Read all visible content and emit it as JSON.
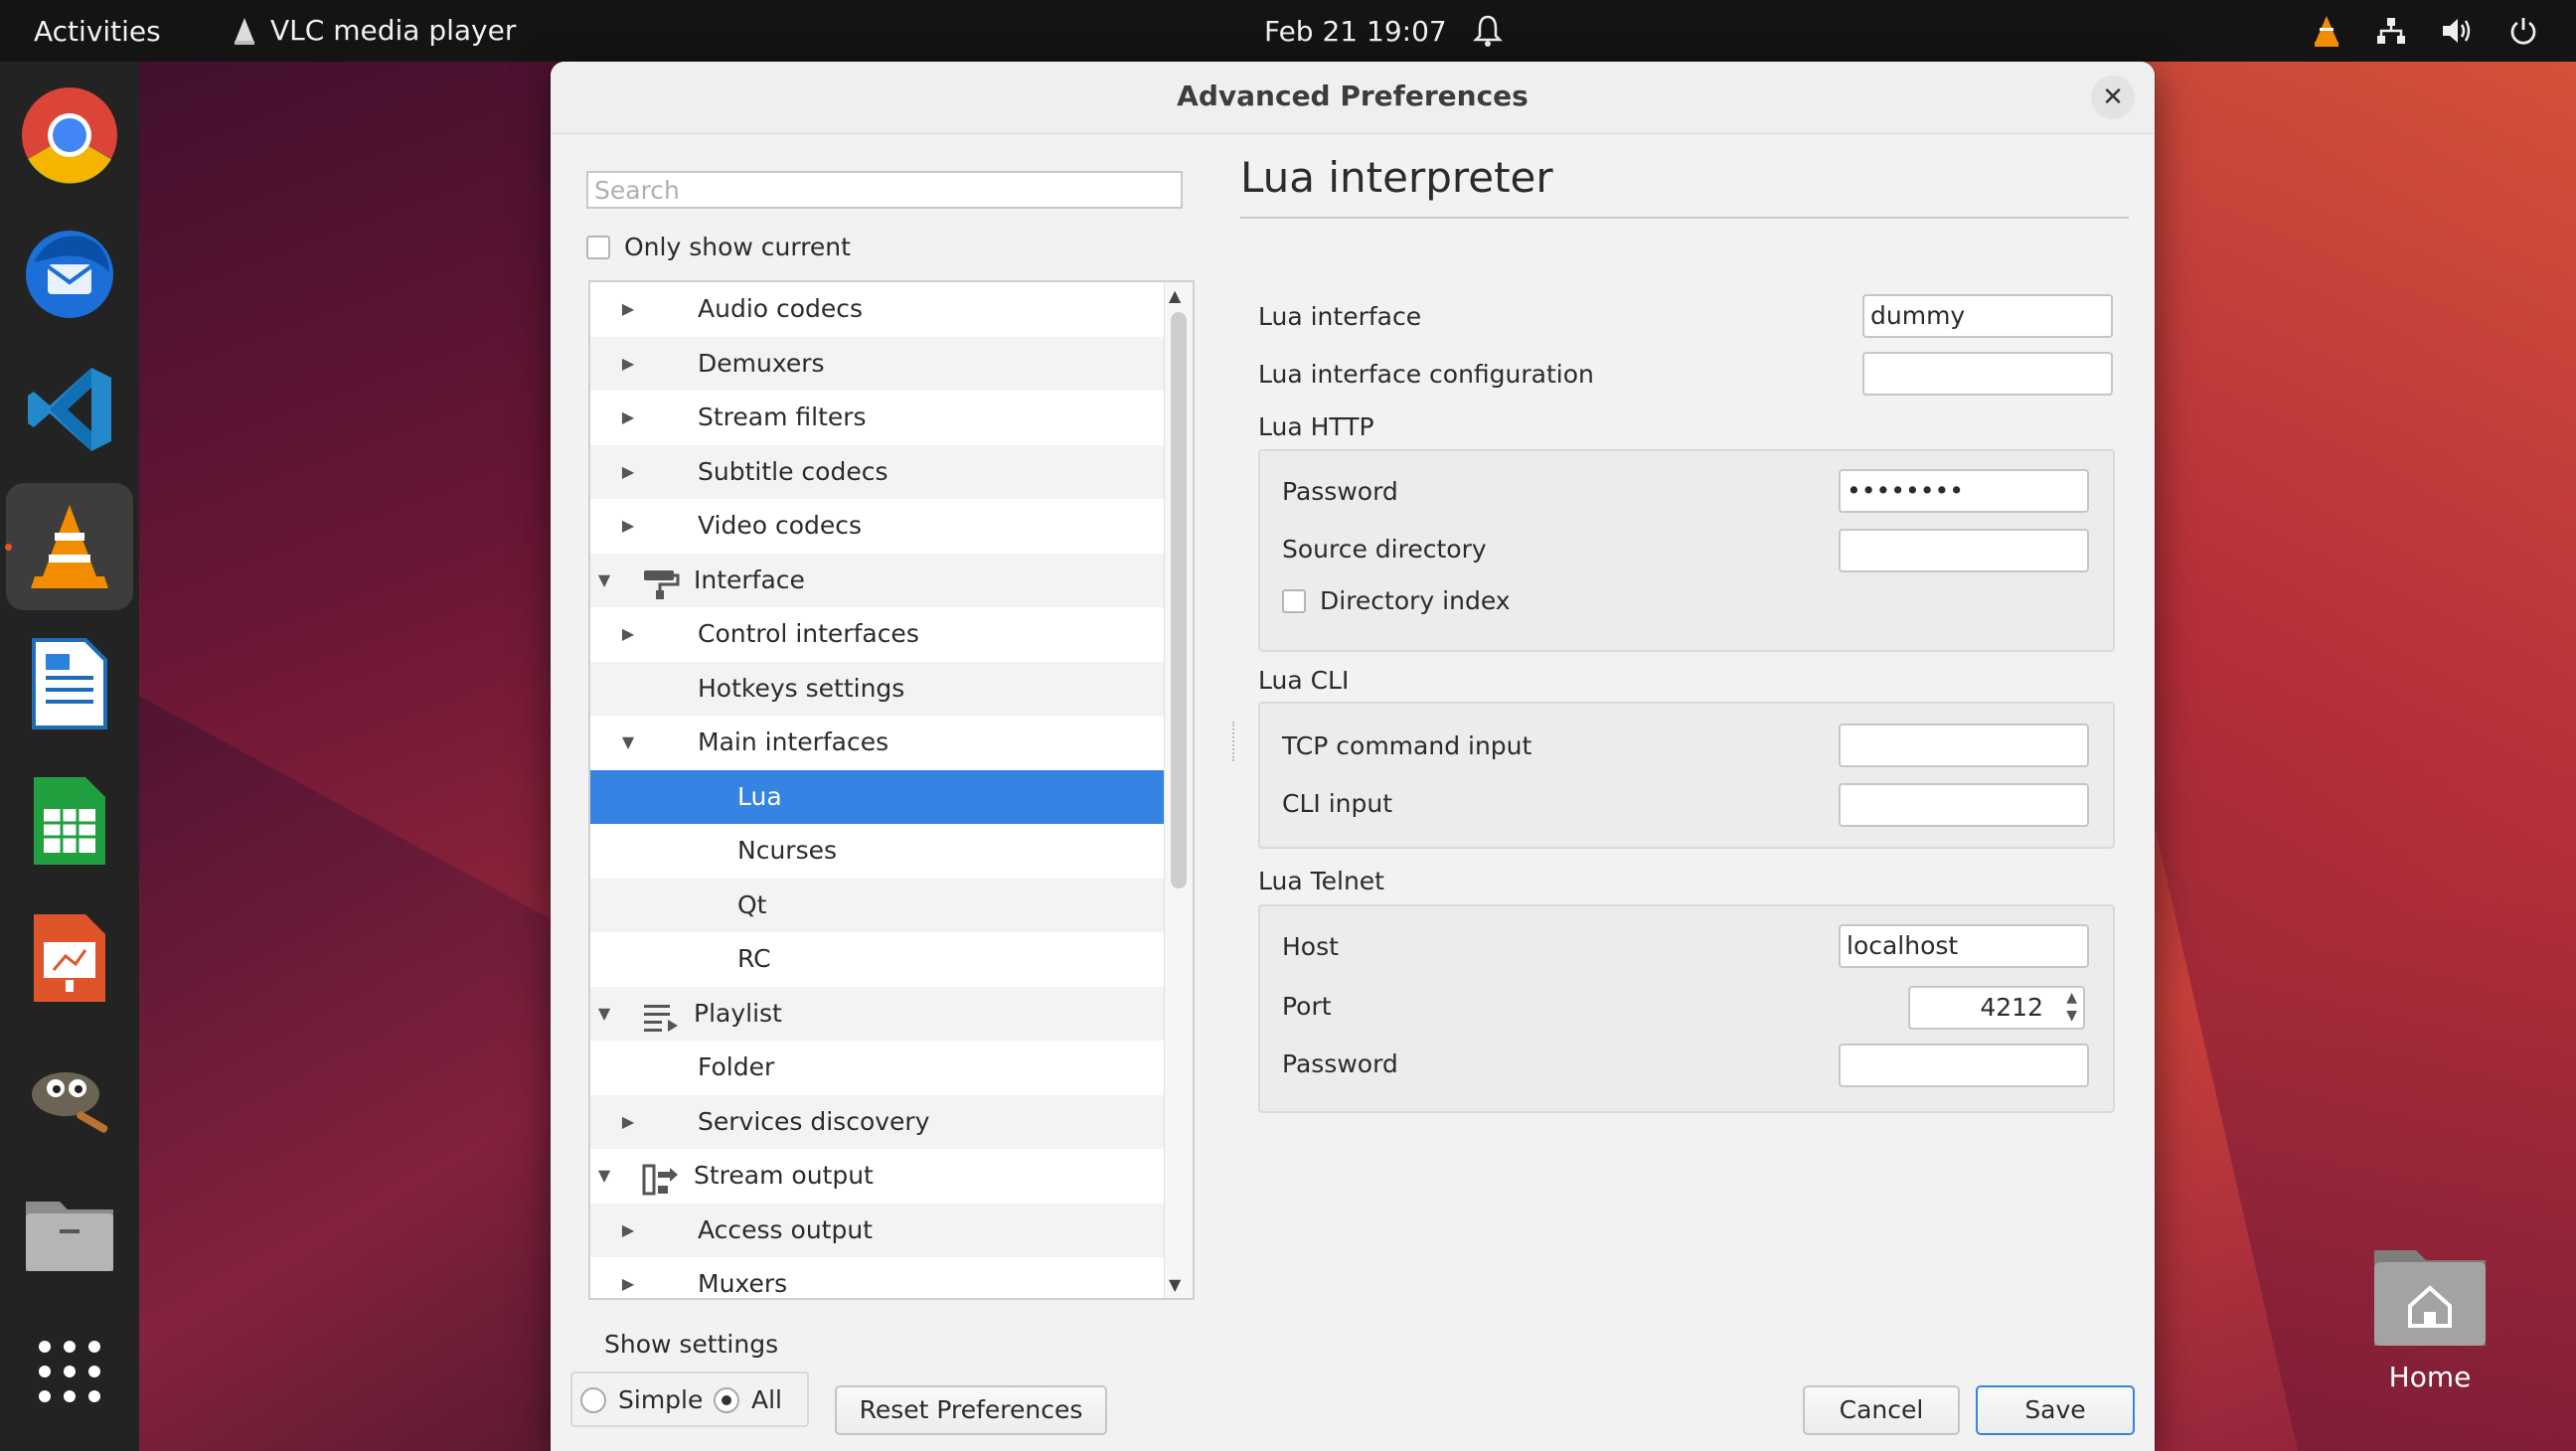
{
  "topbar": {
    "activities": "Activities",
    "app_name": "VLC media player",
    "clock": "Feb 21  19:07"
  },
  "dock": {
    "items": [
      "chrome-icon",
      "thunderbird-icon",
      "vscode-icon",
      "vlc-icon",
      "writer-icon",
      "calc-icon",
      "impress-icon",
      "gimp-icon",
      "files-icon",
      "app-grid-icon"
    ]
  },
  "desktop": {
    "home_label": "Home"
  },
  "dialog": {
    "title": "Advanced Preferences",
    "search_placeholder": "Search",
    "only_show_current": "Only show current",
    "tree": [
      {
        "label": "Audio codecs",
        "level": 1,
        "expander": "collapsed"
      },
      {
        "label": "Demuxers",
        "level": 1,
        "expander": "collapsed"
      },
      {
        "label": "Stream filters",
        "level": 1,
        "expander": "collapsed"
      },
      {
        "label": "Subtitle codecs",
        "level": 1,
        "expander": "collapsed"
      },
      {
        "label": "Video codecs",
        "level": 1,
        "expander": "collapsed"
      },
      {
        "label": "Interface",
        "level": 0,
        "expander": "expanded",
        "icon": "paint-roller-icon"
      },
      {
        "label": "Control interfaces",
        "level": 1,
        "expander": "collapsed"
      },
      {
        "label": "Hotkeys settings",
        "level": 1,
        "expander": "none"
      },
      {
        "label": "Main interfaces",
        "level": 1,
        "expander": "expanded"
      },
      {
        "label": "Lua",
        "level": 2,
        "expander": "none",
        "selected": true
      },
      {
        "label": "Ncurses",
        "level": 2,
        "expander": "none"
      },
      {
        "label": "Qt",
        "level": 2,
        "expander": "none"
      },
      {
        "label": "RC",
        "level": 2,
        "expander": "none"
      },
      {
        "label": "Playlist",
        "level": 0,
        "expander": "expanded",
        "icon": "playlist-icon"
      },
      {
        "label": "Folder",
        "level": 1,
        "expander": "none"
      },
      {
        "label": "Services discovery",
        "level": 1,
        "expander": "collapsed"
      },
      {
        "label": "Stream output",
        "level": 0,
        "expander": "expanded",
        "icon": "stream-output-icon"
      },
      {
        "label": "Access output",
        "level": 1,
        "expander": "collapsed"
      },
      {
        "label": "Muxers",
        "level": 1,
        "expander": "collapsed"
      }
    ],
    "panel": {
      "title": "Lua interpreter",
      "lua_interface_label": "Lua interface",
      "lua_interface_value": "dummy",
      "lua_interface_config_label": "Lua interface configuration",
      "lua_interface_config_value": "",
      "http": {
        "title": "Lua HTTP",
        "password_label": "Password",
        "password_value": "••••••••",
        "source_dir_label": "Source directory",
        "source_dir_value": "",
        "dir_index_label": "Directory index"
      },
      "cli": {
        "title": "Lua CLI",
        "tcp_label": "TCP command input",
        "tcp_value": "",
        "cli_label": "CLI input",
        "cli_value": ""
      },
      "telnet": {
        "title": "Lua Telnet",
        "host_label": "Host",
        "host_value": "localhost",
        "port_label": "Port",
        "port_value": "4212",
        "password_label": "Password",
        "password_value": ""
      }
    },
    "show_settings": "Show settings",
    "mode_simple": "Simple",
    "mode_all": "All",
    "reset_label": "Reset Preferences",
    "cancel_label": "Cancel",
    "save_label": "Save"
  },
  "colors": {
    "accent": "#3584e4",
    "vlc_orange": "#f28c00",
    "ubuntu_orange": "#e95420"
  }
}
